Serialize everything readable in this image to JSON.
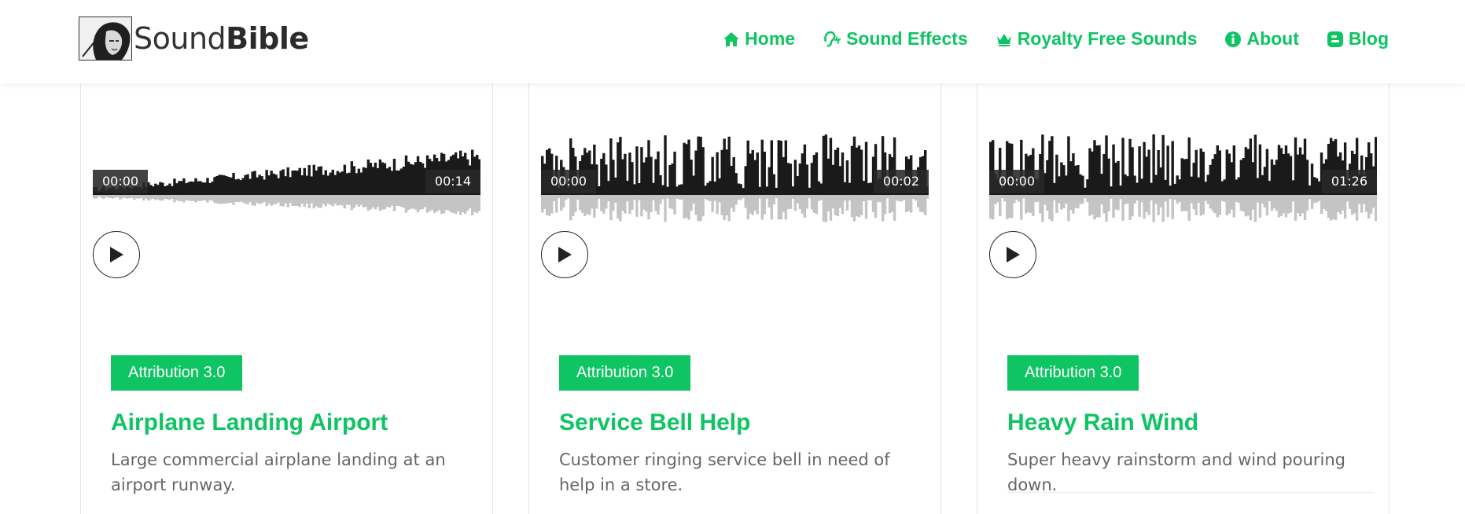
{
  "brand": {
    "name_light": "Sound",
    "name_bold": "Bible"
  },
  "nav": [
    {
      "label": "Home",
      "icon": "home-icon"
    },
    {
      "label": "Sound Effects",
      "icon": "ear-icon"
    },
    {
      "label": "Royalty Free Sounds",
      "icon": "crown-icon"
    },
    {
      "label": "About",
      "icon": "info-icon"
    },
    {
      "label": "Blog",
      "icon": "blog-icon"
    }
  ],
  "colors": {
    "accent": "#0fc463",
    "wave_top": "#1a1a1a",
    "wave_reflection": "#c4c4c4"
  },
  "cards": [
    {
      "start_time": "00:00",
      "end_time": "00:14",
      "license": "Attribution 3.0",
      "title": "Airplane Landing Airport",
      "description": "Large commercial airplane landing at an airport runway."
    },
    {
      "start_time": "00:00",
      "end_time": "00:02",
      "license": "Attribution 3.0",
      "title": "Service Bell Help",
      "description": "Customer ringing service bell in need of help in a store."
    },
    {
      "start_time": "00:00",
      "end_time": "01:26",
      "license": "Attribution 3.0",
      "title": "Heavy Rain Wind",
      "description": "Super heavy rainstorm and wind pouring down."
    }
  ]
}
